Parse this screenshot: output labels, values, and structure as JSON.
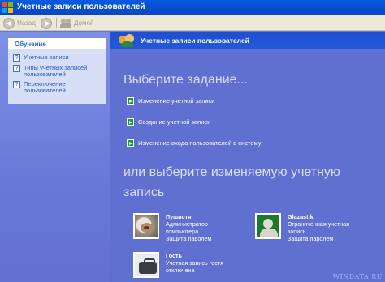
{
  "window": {
    "title": "Учетные записи пользователей"
  },
  "toolbar": {
    "back_label": "Назад",
    "home_label": "Домой"
  },
  "left_panel": {
    "heading": "Обучение",
    "links": [
      {
        "label": "Учетные записи"
      },
      {
        "label": "Типы учетных записей пользователей"
      },
      {
        "label": "Переключение пользователей"
      }
    ]
  },
  "main": {
    "header_title": "Учетные записи пользователей",
    "pick_task_heading": "Выберите задание...",
    "tasks": [
      {
        "label": "Изменение учетной записи"
      },
      {
        "label": "Создание учетной записи"
      },
      {
        "label": "Изменение входа пользователей в систему"
      }
    ],
    "pick_account_heading": "или выберите изменяемую учетную запись",
    "accounts": [
      {
        "name": "Пушистя",
        "line1": "Администратор",
        "line2": "компьютера",
        "line3": "Защита паролем"
      },
      {
        "name": "Glazastik",
        "line1": "Ограниченная учетная",
        "line2": "запись",
        "line3": "Защита паролем"
      },
      {
        "name": "Гость",
        "line1": "Учетная запись гостя",
        "line2": "отключена",
        "line3": ""
      }
    ]
  },
  "watermark": "WINDATA.RU",
  "colors": {
    "title_bar": "#0a50d4",
    "left_panel": "#7c91e6",
    "content_bg": "#6070d0",
    "task_arrow": "#1e9a2e"
  }
}
